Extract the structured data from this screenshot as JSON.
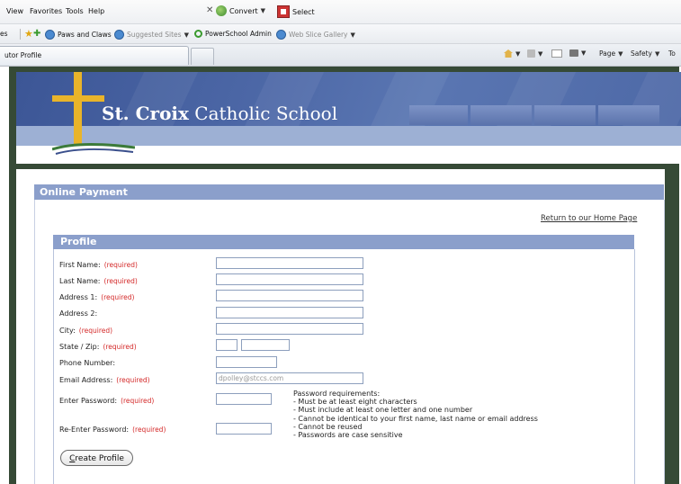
{
  "menubar": {
    "items": [
      "View",
      "Favorites",
      "Tools",
      "Help"
    ],
    "convert": "Convert",
    "select": "Select"
  },
  "favorites": {
    "partial_label": "es",
    "items": [
      {
        "label": "Paws and Claws",
        "icon": "ie-icon"
      },
      {
        "label": "Suggested Sites",
        "icon": "ie-plus-icon"
      },
      {
        "label": "PowerSchool Admin",
        "icon": "powerschool-icon"
      },
      {
        "label": "Web Slice Gallery",
        "icon": "ie-icon"
      }
    ]
  },
  "tab": {
    "title": "utor Profile"
  },
  "toolbar": {
    "page": "Page",
    "safety": "Safety",
    "tools_partial": "To"
  },
  "school": {
    "name_bold": "St. Croix",
    "name_rest": " Catholic School"
  },
  "online_payment": {
    "title": "Online Payment",
    "return_link": "Return to our Home Page"
  },
  "profile": {
    "title": "Profile",
    "fields": [
      {
        "label": "First Name:",
        "required": "(required)",
        "value": ""
      },
      {
        "label": "Last Name:",
        "required": "(required)",
        "value": ""
      },
      {
        "label": "Address 1:",
        "required": "(required)",
        "value": ""
      },
      {
        "label": "Address 2:",
        "required": "",
        "value": ""
      },
      {
        "label": "City:",
        "required": "(required)",
        "value": ""
      },
      {
        "label": "State / Zip:",
        "required": "(required)",
        "value": ""
      },
      {
        "label": "Phone Number:",
        "required": "",
        "value": ""
      },
      {
        "label": "Email Address:",
        "required": "(required)",
        "value": "dpolley@stccs.com"
      },
      {
        "label": "Enter Password:",
        "required": "(required)",
        "value": ""
      },
      {
        "label": "Re-Enter Password:",
        "required": "(required)",
        "value": ""
      }
    ],
    "password_requirements": "Password requirements:\n- Must be at least eight characters\n- Must include at least one letter and one number\n- Cannot be identical to your first name, last name or email address\n- Cannot be reused\n- Passwords are case sensitive",
    "button_first_letter": "C",
    "button_rest": "reate Profile"
  },
  "colors": {
    "header_bar": "#8b9fcb",
    "required": "#d42a2a",
    "frame": "#364a36",
    "banner": "#4c67a6",
    "cross": "#e9b42a"
  }
}
